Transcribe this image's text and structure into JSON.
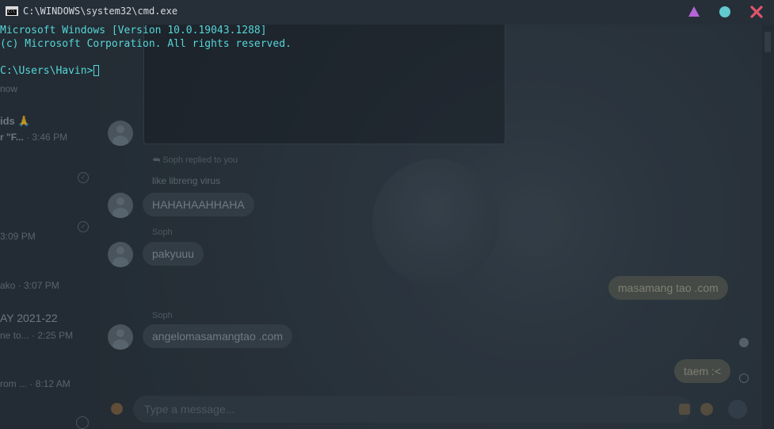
{
  "window": {
    "title": "C:\\WINDOWS\\system32\\cmd.exe",
    "icon": "cmd-icon",
    "buttons": [
      {
        "name": "minimize-icon",
        "color": "#b565d8"
      },
      {
        "name": "maximize-icon",
        "color": "#62c9d1"
      },
      {
        "name": "close-icon",
        "color": "#e0556a"
      }
    ]
  },
  "console": {
    "lines": [
      "Microsoft Windows [Version 10.0.19043.1288]",
      "(c) Microsoft Corporation. All rights reserved.",
      "",
      "C:\\Users\\Havin>"
    ],
    "text_color": "#56d6d8"
  },
  "background_app": {
    "chat_list": {
      "items": [
        {
          "line1": "now"
        },
        {
          "name": "ids 🙏",
          "line2": "r \"F...",
          "time": "· 3:46 PM"
        },
        {
          "time": "3:09 PM"
        },
        {
          "preview": "ako",
          "time": "· 3:07 PM"
        },
        {
          "name": "AY 2021-22",
          "preview": "ne to...",
          "time": "· 2:25 PM"
        },
        {
          "preview": "rom ...",
          "time": "· 8:12 AM"
        }
      ]
    },
    "messages": {
      "reply_note": "Soph replied to you",
      "quoted": "like libreng virus",
      "msg1": "HAHAHAAHHAHA",
      "sender1": "Soph",
      "msg2": "pakyuuu",
      "mine1": "masamang tao .com",
      "sender2": "Soph",
      "msg3": "angelomasamangtao .com",
      "mine2": "taem :<"
    },
    "composer": {
      "placeholder": "Type a message..."
    },
    "accent": "#a7a28c"
  }
}
